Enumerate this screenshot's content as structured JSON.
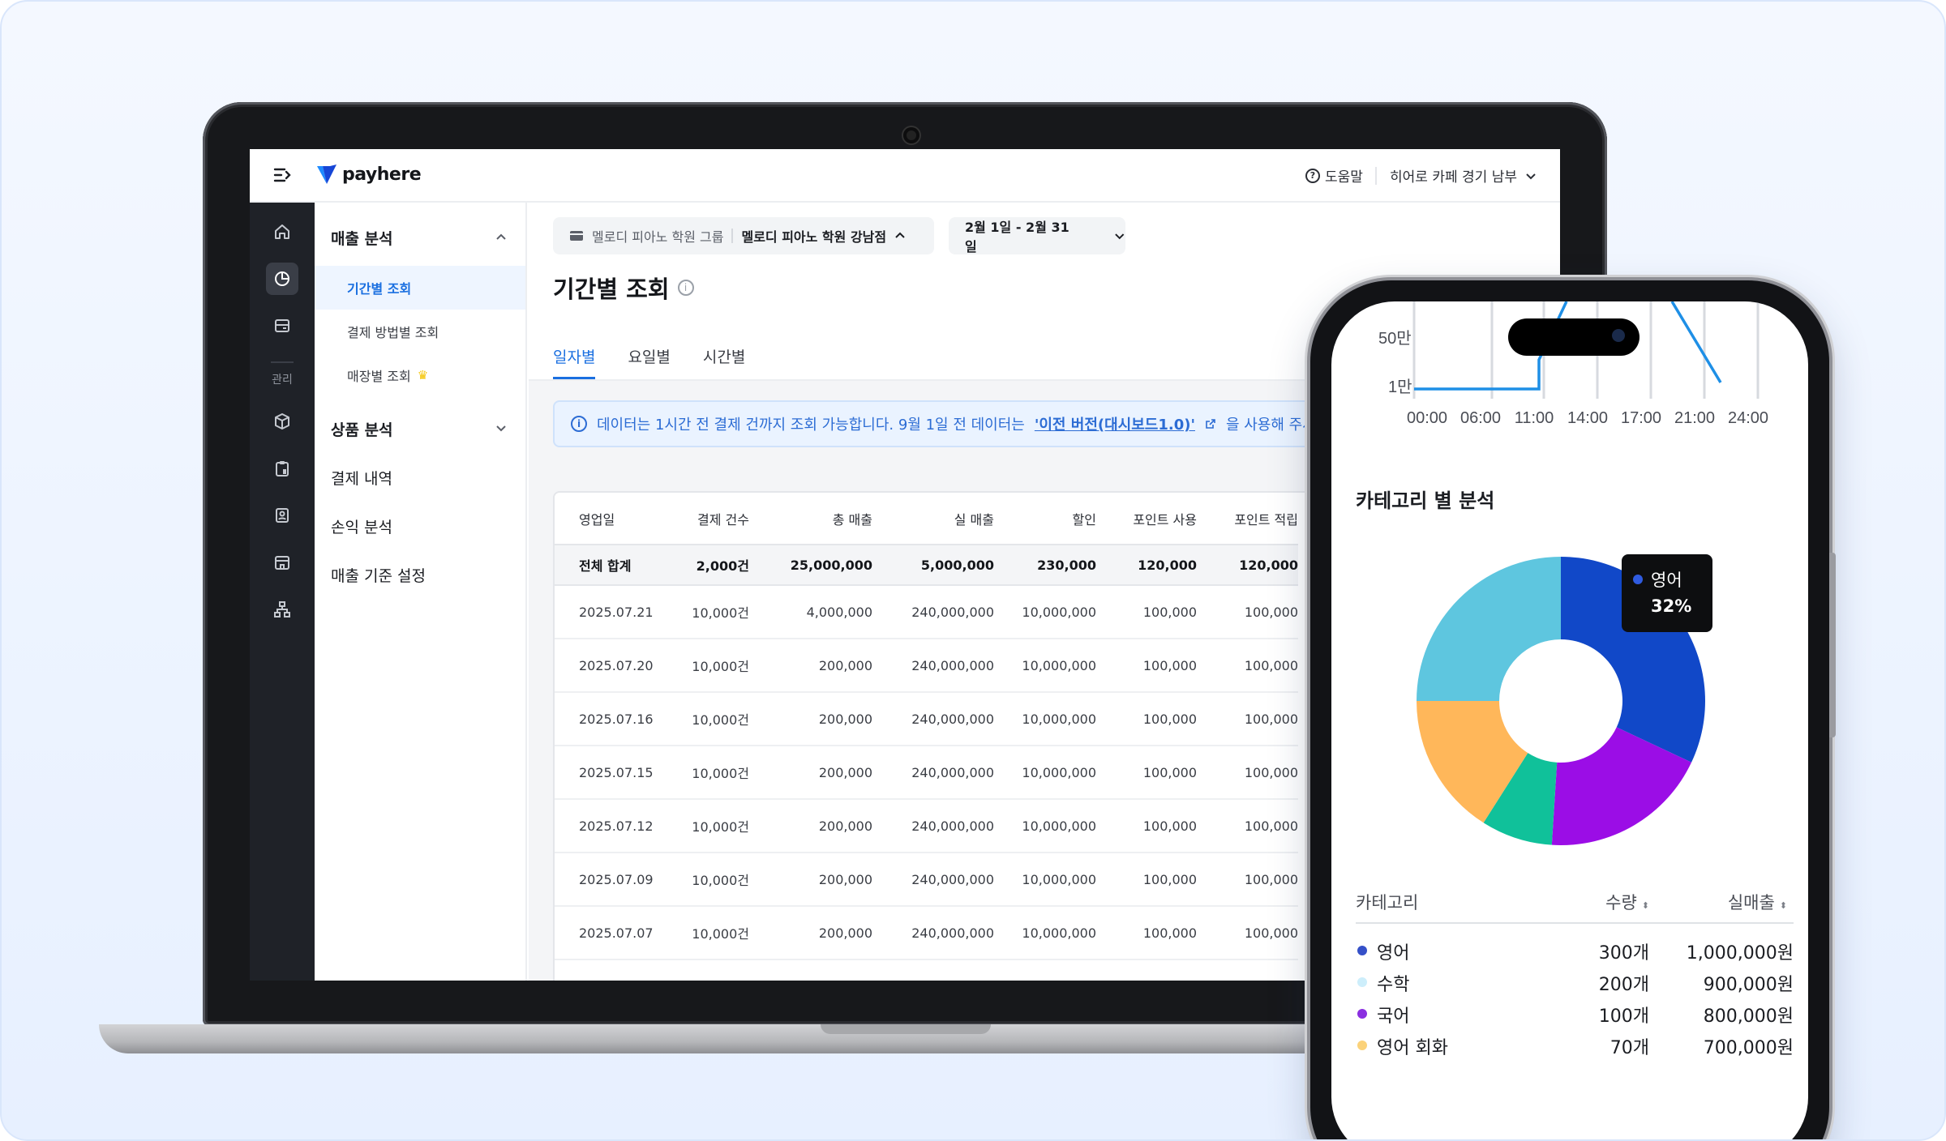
{
  "brand": {
    "name": "payhere",
    "accent": "#1a6fe0"
  },
  "topbar": {
    "help_label": "도움말",
    "store_label": "히어로 카페 경기 남부"
  },
  "rail": {
    "manage_label": "관리"
  },
  "nav": {
    "sales_group": "매출 분석",
    "sales_items": [
      "기간별 조회",
      "결제 방법별 조회",
      "매장별 조회"
    ],
    "product_group": "상품 분석",
    "payment_history": "결제 내역",
    "profit": "손익 분석",
    "sales_settings": "매출 기준 설정"
  },
  "filters": {
    "group": "멜로디 피아노 학원 그룹",
    "branch": "멜로디 피아노 학원 강남점",
    "date_range": "2월 1일 - 2월 31일"
  },
  "page": {
    "title": "기간별 조회"
  },
  "tabs": [
    "일자별",
    "요일별",
    "시간별"
  ],
  "notice": {
    "text": "데이터는 1시간 전 결제 건까지 조회 가능합니다. 9월 1일 전 데이터는",
    "link": "'이전 버전(대시보드1.0)'",
    "suffix": "을 사용해 주세"
  },
  "table": {
    "headers": [
      "영업일",
      "결제 건수",
      "총 매출",
      "실 매출",
      "할인",
      "포인트 사용",
      "포인트 적립"
    ],
    "total": [
      "전체 합계",
      "2,000건",
      "25,000,000",
      "5,000,000",
      "230,000",
      "120,000",
      "120,000"
    ],
    "rows": [
      [
        "2025.07.21",
        "10,000건",
        "4,000,000",
        "240,000,000",
        "10,000,000",
        "100,000",
        "100,000"
      ],
      [
        "2025.07.20",
        "10,000건",
        "200,000",
        "240,000,000",
        "10,000,000",
        "100,000",
        "100,000"
      ],
      [
        "2025.07.16",
        "10,000건",
        "200,000",
        "240,000,000",
        "10,000,000",
        "100,000",
        "100,000"
      ],
      [
        "2025.07.15",
        "10,000건",
        "200,000",
        "240,000,000",
        "10,000,000",
        "100,000",
        "100,000"
      ],
      [
        "2025.07.12",
        "10,000건",
        "200,000",
        "240,000,000",
        "10,000,000",
        "100,000",
        "100,000"
      ],
      [
        "2025.07.09",
        "10,000건",
        "200,000",
        "240,000,000",
        "10,000,000",
        "100,000",
        "100,000"
      ],
      [
        "2025.07.07",
        "10,000건",
        "200,000",
        "240,000,000",
        "10,000,000",
        "100,000",
        "100,000"
      ]
    ]
  },
  "phone": {
    "time_chart": {
      "y_ticks": [
        "50만",
        "1만"
      ],
      "x_ticks": [
        "00:00",
        "06:00",
        "11:00",
        "14:00",
        "17:00",
        "21:00",
        "24:00"
      ]
    },
    "category_title": "카테고리 별 분석",
    "tooltip": {
      "name": "영어",
      "percent": "32%"
    },
    "legend_headers": {
      "category": "카테고리",
      "qty": "수량",
      "amount": "실매출"
    },
    "categories": [
      {
        "name": "영어",
        "qty": "300개",
        "amount": "1,000,000원",
        "color": "#3550c8"
      },
      {
        "name": "수학",
        "qty": "200개",
        "amount": "900,000원",
        "color": "#cdeefb"
      },
      {
        "name": "국어",
        "qty": "100개",
        "amount": "800,000원",
        "color": "#8a2fe0"
      },
      {
        "name": "영어 회화",
        "qty": "70개",
        "amount": "700,000원",
        "color": "#fbd27a"
      }
    ]
  },
  "chart_data": {
    "type": "pie",
    "title": "카테고리 별 분석",
    "slices": [
      {
        "label": "영어",
        "percent": 32,
        "color": "#1148c8"
      },
      {
        "label": "",
        "percent": 19,
        "color": "#9b0de6"
      },
      {
        "label": "",
        "percent": 8,
        "color": "#10c19a"
      },
      {
        "label": "",
        "percent": 16,
        "color": "#ffb75a"
      },
      {
        "label": "",
        "percent": 25,
        "color": "#5ec6df"
      }
    ]
  }
}
